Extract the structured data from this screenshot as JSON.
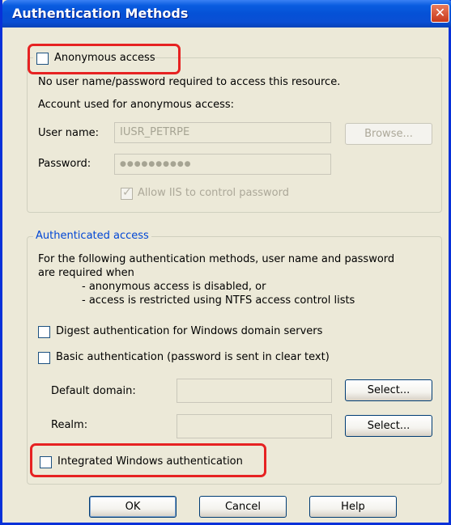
{
  "window": {
    "title": "Authentication Methods",
    "close_glyph": "✕"
  },
  "anonymous": {
    "checkbox_label": "Anonymous access",
    "description": "No user name/password required to access this resource.",
    "account_heading": "Account used for anonymous access:",
    "username_label": "User name:",
    "username_value": "IUSR_PETRPE",
    "browse_label": "Browse...",
    "password_label": "Password:",
    "password_value": "●●●●●●●●●●",
    "allow_iis_label": "Allow IIS to control password",
    "allow_iis_checked": true
  },
  "authenticated": {
    "legend": "Authenticated access",
    "description_line1": "For the following authentication methods, user name and password",
    "description_line2": "are required when",
    "bullet1": "- anonymous access is disabled, or",
    "bullet2": "- access is restricted using NTFS access control lists",
    "digest_label": "Digest authentication for Windows domain servers",
    "basic_label": "Basic authentication (password is sent in clear text)",
    "default_domain_label": "Default domain:",
    "realm_label": "Realm:",
    "select_label": "Select...",
    "integrated_label": "Integrated Windows authentication"
  },
  "footer": {
    "ok_label": "OK",
    "cancel_label": "Cancel",
    "help_label": "Help"
  },
  "colors": {
    "highlight": "#e62222",
    "legend": "#0046d5",
    "title_bar": "#0551d6"
  }
}
